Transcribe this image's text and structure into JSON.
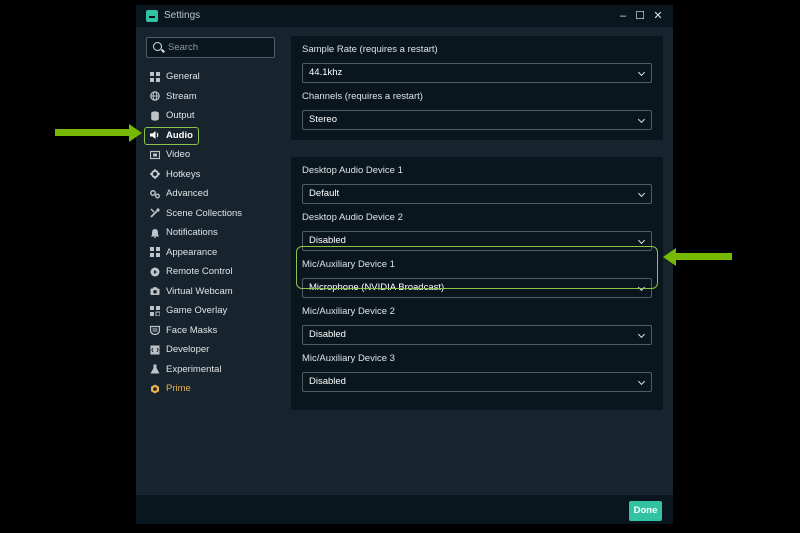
{
  "window": {
    "title": "Settings",
    "controls": {
      "minimize": "–",
      "maximize": "☐",
      "close": "✕"
    }
  },
  "search": {
    "placeholder": "Search"
  },
  "sidebar": {
    "items": [
      {
        "label": "General",
        "icon": "grid-icon"
      },
      {
        "label": "Stream",
        "icon": "globe-icon"
      },
      {
        "label": "Output",
        "icon": "database-icon"
      },
      {
        "label": "Audio",
        "icon": "speaker-icon",
        "active": true
      },
      {
        "label": "Video",
        "icon": "film-icon"
      },
      {
        "label": "Hotkeys",
        "icon": "gear-icon"
      },
      {
        "label": "Advanced",
        "icon": "gears-icon"
      },
      {
        "label": "Scene Collections",
        "icon": "tools-icon"
      },
      {
        "label": "Notifications",
        "icon": "bell-icon"
      },
      {
        "label": "Appearance",
        "icon": "squares-icon"
      },
      {
        "label": "Remote Control",
        "icon": "play-icon"
      },
      {
        "label": "Virtual Webcam",
        "icon": "camera-icon"
      },
      {
        "label": "Game Overlay",
        "icon": "overlay-icon"
      },
      {
        "label": "Face Masks",
        "icon": "mask-icon"
      },
      {
        "label": "Developer",
        "icon": "code-icon"
      },
      {
        "label": "Experimental",
        "icon": "flask-icon"
      },
      {
        "label": "Prime",
        "icon": "prime-icon",
        "prime": true
      }
    ]
  },
  "general_audio": {
    "sample_rate": {
      "label": "Sample Rate (requires a restart)",
      "value": "44.1khz"
    },
    "channels": {
      "label": "Channels (requires a restart)",
      "value": "Stereo"
    }
  },
  "devices": {
    "desktop1": {
      "label": "Desktop Audio Device 1",
      "value": "Default"
    },
    "desktop2": {
      "label": "Desktop Audio Device 2",
      "value": "Disabled"
    },
    "mic1": {
      "label": "Mic/Auxiliary Device 1",
      "value": "Microphone (NVIDIA Broadcast)"
    },
    "mic2": {
      "label": "Mic/Auxiliary Device 2",
      "value": "Disabled"
    },
    "mic3": {
      "label": "Mic/Auxiliary Device 3",
      "value": "Disabled"
    }
  },
  "footer": {
    "done_label": "Done"
  },
  "colors": {
    "accent": "#31c3a2",
    "highlight": "#8bc34a",
    "annotation_arrow": "#77b900",
    "prime": "#e8b04d"
  }
}
